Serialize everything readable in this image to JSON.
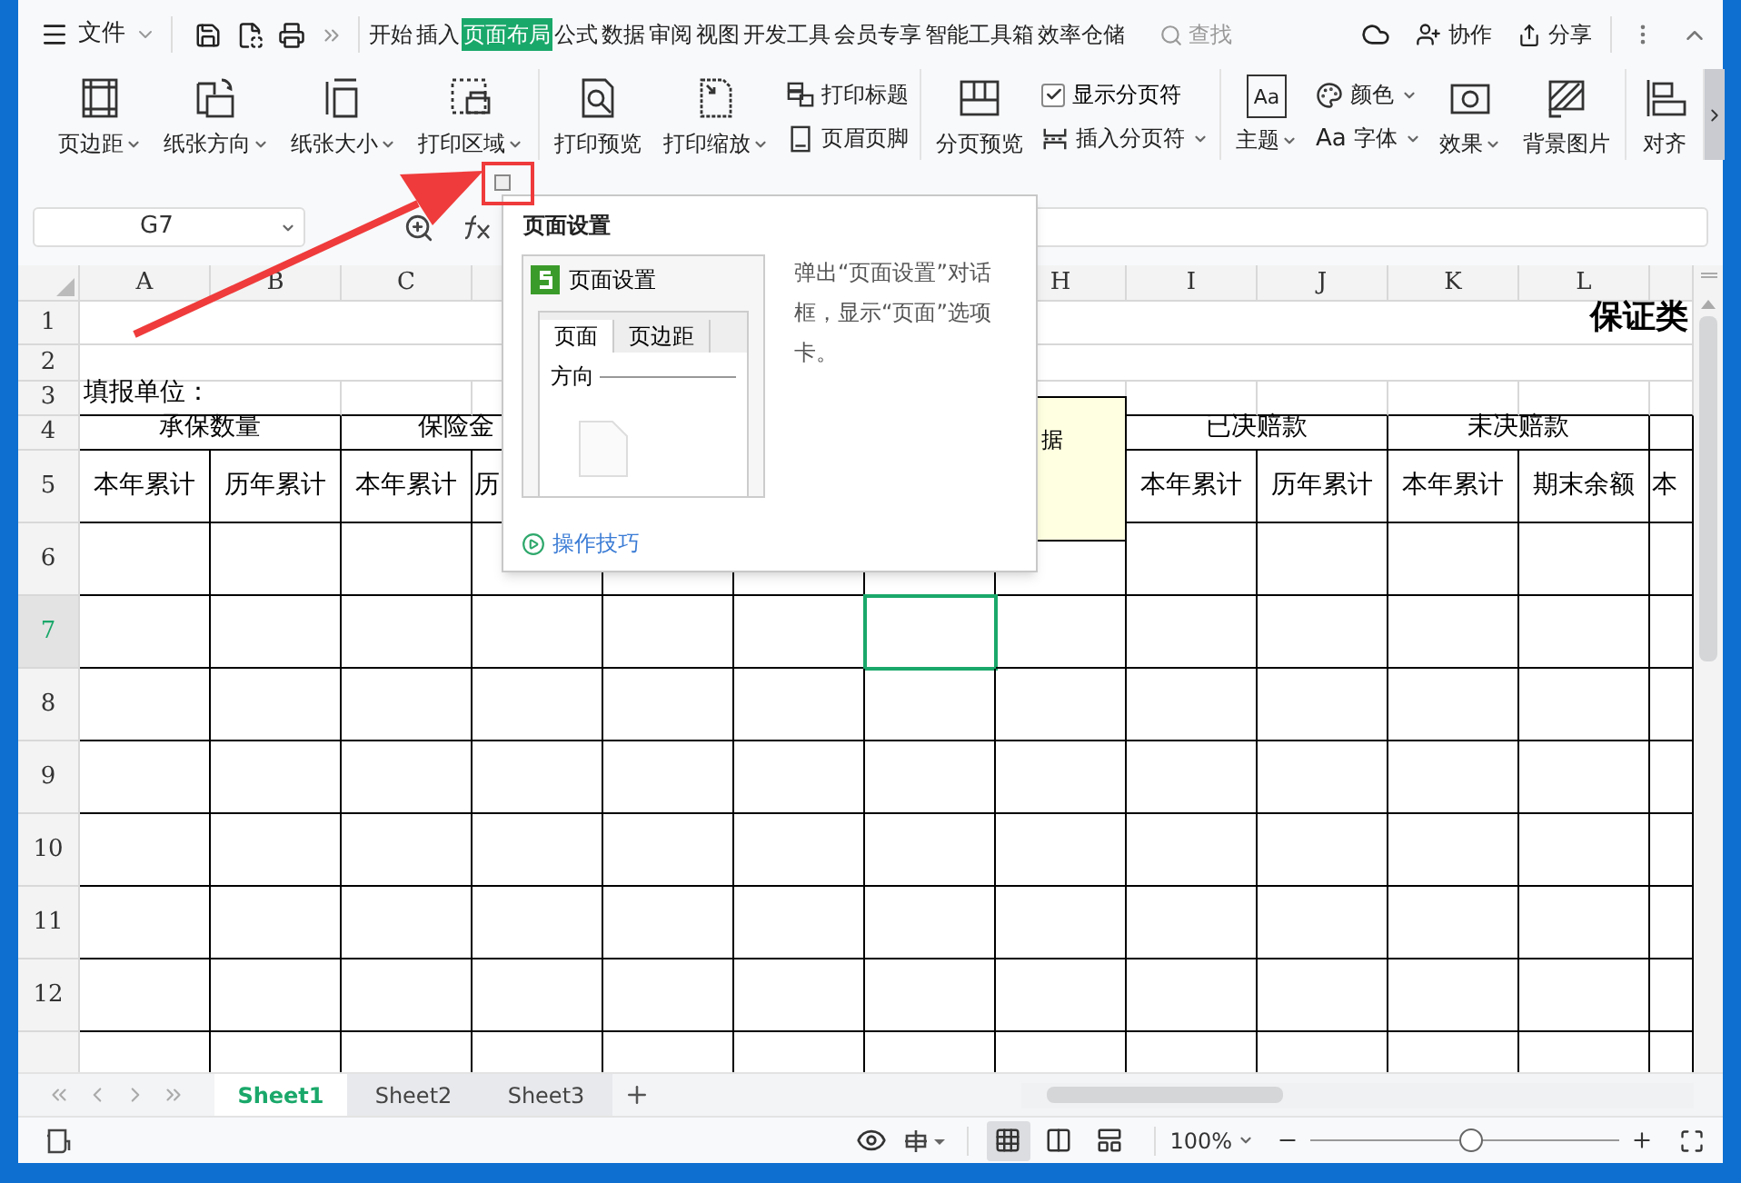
{
  "menu": {
    "label": "文件"
  },
  "tabs": [
    {
      "label": "开始",
      "selected": false
    },
    {
      "label": "插入",
      "selected": false
    },
    {
      "label": "页面布局",
      "selected": true
    },
    {
      "label": "公式",
      "selected": false
    },
    {
      "label": "数据",
      "selected": false
    },
    {
      "label": "审阅",
      "selected": false
    },
    {
      "label": "视图",
      "selected": false
    },
    {
      "label": "开发工具",
      "selected": false
    },
    {
      "label": "会员专享",
      "selected": false
    },
    {
      "label": "智能工具箱",
      "selected": false
    },
    {
      "label": "效率仓储",
      "selected": false
    }
  ],
  "search": {
    "placeholder": "查找"
  },
  "header_actions": [
    "协作",
    "分享"
  ],
  "ribbon": [
    [
      {
        "kind": "large",
        "label": "页边距",
        "dropdown": true
      },
      {
        "kind": "large",
        "label": "纸张方向",
        "dropdown": true
      },
      {
        "kind": "large",
        "label": "纸张大小",
        "dropdown": true
      },
      {
        "kind": "large",
        "label": "打印区域",
        "dropdown": true
      }
    ],
    [
      {
        "kind": "large",
        "label": "打印预览",
        "dropdown": false
      },
      {
        "kind": "large",
        "label": "打印缩放",
        "dropdown": true
      },
      {
        "kind": "stack",
        "items": [
          {
            "kind": "button",
            "label": "打印标题",
            "dropdown": false
          },
          {
            "kind": "button",
            "label": "页眉页脚",
            "dropdown": false
          }
        ]
      }
    ],
    [
      {
        "kind": "large",
        "label": "分页预览",
        "dropdown": false
      },
      {
        "kind": "stack",
        "items": [
          {
            "kind": "checkbox",
            "label": "显示分页符",
            "checked": true
          },
          {
            "kind": "button",
            "label": "插入分页符",
            "dropdown": true
          }
        ]
      }
    ],
    [
      {
        "kind": "large",
        "label": "主题",
        "glyph": "Aa",
        "dropdown": true
      },
      {
        "kind": "stack",
        "items": [
          {
            "kind": "button",
            "label": "颜色",
            "dropdown": true
          },
          {
            "kind": "button",
            "label": "字体",
            "glyph": "Aa",
            "dropdown": true
          }
        ]
      },
      {
        "kind": "large",
        "label": "效果",
        "dropdown": true
      },
      {
        "kind": "large",
        "label": "背景图片",
        "dropdown": false
      }
    ],
    [
      {
        "kind": "large",
        "label": "对齐",
        "dropdown": false
      }
    ]
  ],
  "name_box": "G7",
  "columns": [
    "A",
    "B",
    "C",
    null,
    null,
    null,
    null,
    "H",
    "I",
    "J",
    "K",
    "L",
    null
  ],
  "rows": [
    {
      "label": "1",
      "selected": false,
      "cells": [
        {
          "text": "保证类"
        }
      ]
    },
    {
      "label": "2",
      "selected": false,
      "cells": [
        {}
      ]
    },
    {
      "label": "3",
      "selected": false,
      "cells": [
        {
          "text": "填报单位："
        }
      ]
    },
    {
      "label": "4",
      "selected": false,
      "cells": [
        {
          "text": "承保数量"
        },
        {
          "text": "保险金"
        },
        {},
        {
          "text": "已决赔款"
        },
        {
          "text": "未决赔款"
        }
      ]
    },
    {
      "label": "5",
      "selected": false,
      "cells": [
        {
          "text": "本年累计"
        },
        {
          "text": "历年累计"
        },
        {
          "text": "本年累计"
        },
        {
          "text": "历"
        },
        {},
        {
          "text": "本年累计"
        },
        {
          "text": "历年累计"
        },
        {
          "text": "本年累计"
        },
        {
          "text": "期末余额"
        },
        {
          "text": "本"
        }
      ]
    },
    {
      "label": "6",
      "selected": false
    },
    {
      "label": "7",
      "selected": true,
      "cells": [
        {
          "selected": false
        },
        {
          "selected": false
        },
        {
          "selected": false
        },
        {
          "selected": false
        },
        {
          "selected": false
        },
        {
          "selected": false
        },
        {
          "selected": true
        },
        {
          "selected": false
        },
        {
          "selected": false
        },
        {
          "selected": false
        },
        {
          "selected": false
        },
        {
          "selected": false
        },
        {
          "selected": false
        }
      ]
    },
    {
      "label": "8",
      "selected": false
    },
    {
      "label": "9",
      "selected": false
    },
    {
      "label": "10",
      "selected": false
    },
    {
      "label": "11",
      "selected": false
    },
    {
      "label": "12",
      "selected": false
    },
    {
      "selected": false
    }
  ],
  "comment": {
    "text": "据"
  },
  "tooltip": {
    "title": "页面设置",
    "preview": {
      "title": "页面设置",
      "tabs": [
        {
          "label": "页面",
          "selected": true
        },
        {
          "label": "页边距",
          "selected": false
        }
      ],
      "section": "方向"
    },
    "description": "弹出“页面设置”对话框，显示“页面”选项卡。",
    "link": "操作技巧"
  },
  "sheets": [
    {
      "label": "Sheet1",
      "selected": true
    },
    {
      "label": "Sheet2",
      "selected": false
    },
    {
      "label": "Sheet3",
      "selected": false
    }
  ],
  "status": {
    "views": [
      {
        "selected": true
      },
      {
        "selected": false
      },
      {
        "selected": false
      }
    ],
    "zoom": "100%",
    "zoom_slider": {
      "level": 0.52
    }
  }
}
